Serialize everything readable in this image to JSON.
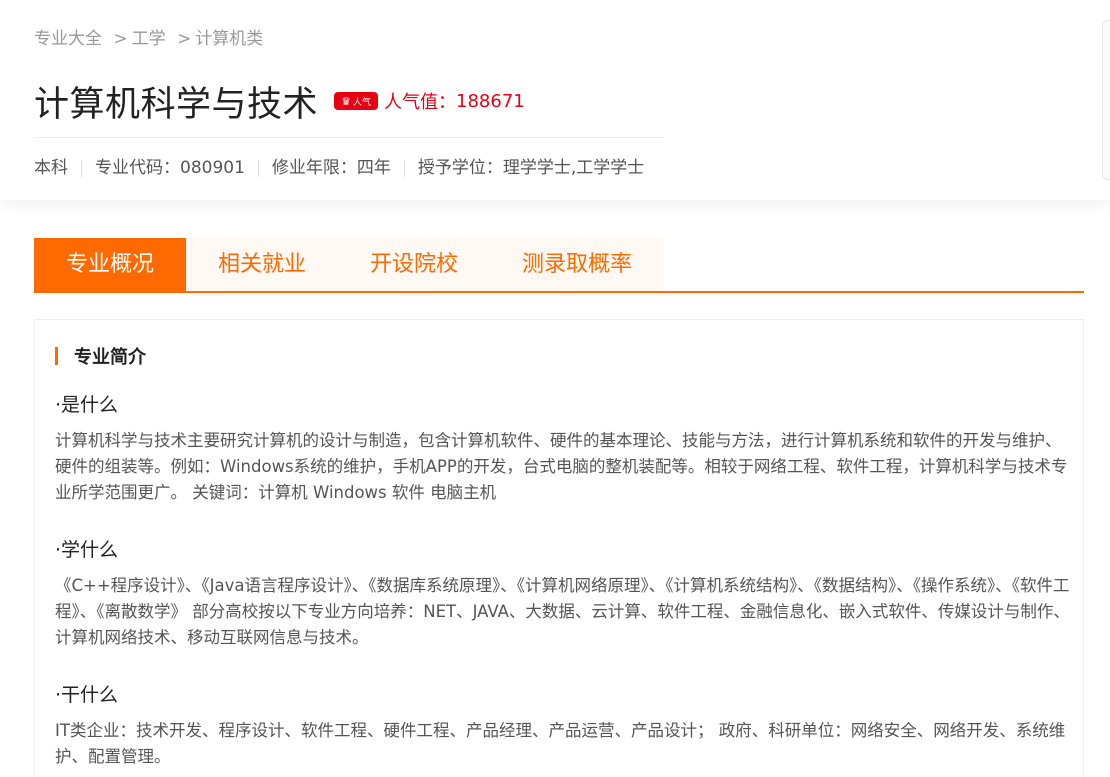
{
  "breadcrumb": {
    "items": [
      "专业大全",
      "工学",
      "计算机类"
    ],
    "separator": ">"
  },
  "major": {
    "title": "计算机科学与技术",
    "badge": {
      "icon": "crown-icon",
      "text": "人气",
      "color": "#e60012"
    },
    "popularity_label": "人气值：",
    "popularity_value": "188671"
  },
  "meta": {
    "level": "本科",
    "code": "专业代码：080901",
    "duration": "修业年限：四年",
    "degree": "授予学位：理学学士,工学学士"
  },
  "tabs": [
    {
      "label": "专业概况",
      "active": true
    },
    {
      "label": "相关就业",
      "active": false
    },
    {
      "label": "开设院校",
      "active": false
    },
    {
      "label": "测录取概率",
      "active": false
    }
  ],
  "section": {
    "title": "专业简介",
    "blocks": [
      {
        "heading": "·是什么",
        "text": "计算机科学与技术主要研究计算机的设计与制造，包含计算机软件、硬件的基本理论、技能与方法，进行计算机系统和软件的开发与维护、硬件的组装等。例如：Windows系统的维护，手机APP的开发，台式电脑的整机装配等。相较于网络工程、软件工程，计算机科学与技术专业所学范围更广。 关键词：计算机 Windows 软件 电脑主机"
      },
      {
        "heading": "·学什么",
        "text": "《C++程序设计》、《Java语言程序设计》、《数据库系统原理》、《计算机网络原理》、《计算机系统结构》、《数据结构》、《操作系统》、《软件工程》、《离散数学》 部分高校按以下专业方向培养：NET、JAVA、大数据、云计算、软件工程、金融信息化、嵌入式软件、传媒设计与制作、计算机网络技术、移动互联网信息与技术。"
      },
      {
        "heading": "·干什么",
        "text": "IT类企业：技术开发、程序设计、软件工程、硬件工程、产品经理、产品运营、产品设计； 政府、科研单位：网络安全、网络开发、系统维护、配置管理。"
      }
    ]
  },
  "colors": {
    "accent": "#ff6a00",
    "popularity": "#e60012",
    "tab_bg": "#fff8f3"
  }
}
